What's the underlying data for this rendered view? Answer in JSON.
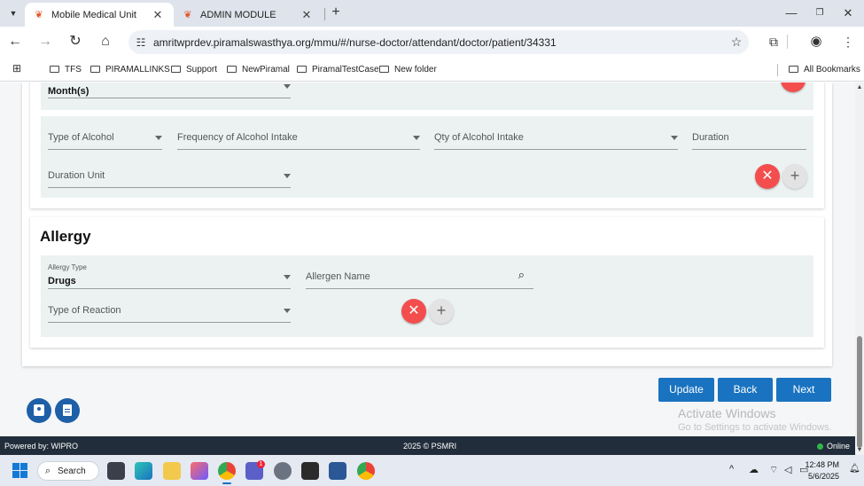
{
  "browser": {
    "tabs": [
      {
        "title": "Mobile Medical Unit"
      },
      {
        "title": "ADMIN MODULE"
      }
    ],
    "url": "amritwprdev.piramalswasthya.org/mmu/#/nurse-doctor/attendant/doctor/patient/34331",
    "bookmarks": [
      "TFS",
      "PIRAMALLINKS",
      "Support",
      "NewPiramal",
      "PiramalTestCase",
      "New folder"
    ],
    "all_bookmarks": "All Bookmarks"
  },
  "tobacco_row": {
    "duration_unit_value": "Month(s)"
  },
  "alcohol_row": {
    "type_label": "Type of Alcohol",
    "frequency_label": "Frequency of Alcohol Intake",
    "qty_label": "Qty of Alcohol Intake",
    "duration_label": "Duration",
    "duration_unit_label": "Duration Unit"
  },
  "allergy": {
    "title": "Allergy",
    "type_small_label": "Allergy Type",
    "type_value": "Drugs",
    "allergen_label": "Allergen Name",
    "reaction_label": "Type of Reaction"
  },
  "actions": {
    "update": "Update",
    "back": "Back",
    "next": "Next"
  },
  "watermark": {
    "line1": "Activate Windows",
    "line2": "Go to Settings to activate Windows."
  },
  "footer": {
    "powered": "Powered by: WIPRO",
    "copyright": "2025 © PSMRI",
    "status": "Online"
  },
  "taskbar": {
    "search": "Search",
    "time": "12:48 PM",
    "date": "5/6/2025",
    "teams_badge": "1"
  },
  "colors": {
    "primary": "#1a73c0",
    "remove": "#f44d4d",
    "row_bg": "#ecf2f2",
    "footer_bg": "#212d3a",
    "online": "#2fb84a"
  }
}
